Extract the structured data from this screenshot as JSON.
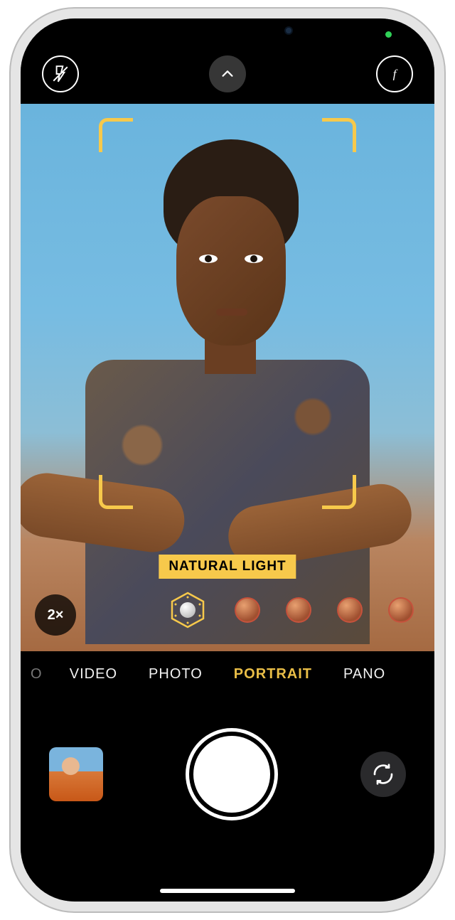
{
  "top": {
    "flash_icon": "flash-off",
    "chevron_icon": "chevron-up",
    "depth_icon": "f-depth"
  },
  "viewfinder": {
    "lighting_label": "NATURAL LIGHT",
    "zoom_label": "2×",
    "focus_color": "#f7c94b"
  },
  "lighting_options": [
    {
      "name": "natural",
      "selected": true
    },
    {
      "name": "studio",
      "selected": false
    },
    {
      "name": "contour",
      "selected": false
    },
    {
      "name": "stage",
      "selected": false
    },
    {
      "name": "stage-mono",
      "selected": false
    }
  ],
  "modes": {
    "items": [
      "VIDEO",
      "PHOTO",
      "PORTRAIT",
      "PANO"
    ],
    "active": "PORTRAIT",
    "edge_left_hint": "O"
  },
  "bottom": {
    "thumbnail_alt": "last-photo",
    "flip_icon": "camera-flip"
  },
  "colors": {
    "accent": "#f7c94b",
    "status_dot": "#30d158"
  }
}
